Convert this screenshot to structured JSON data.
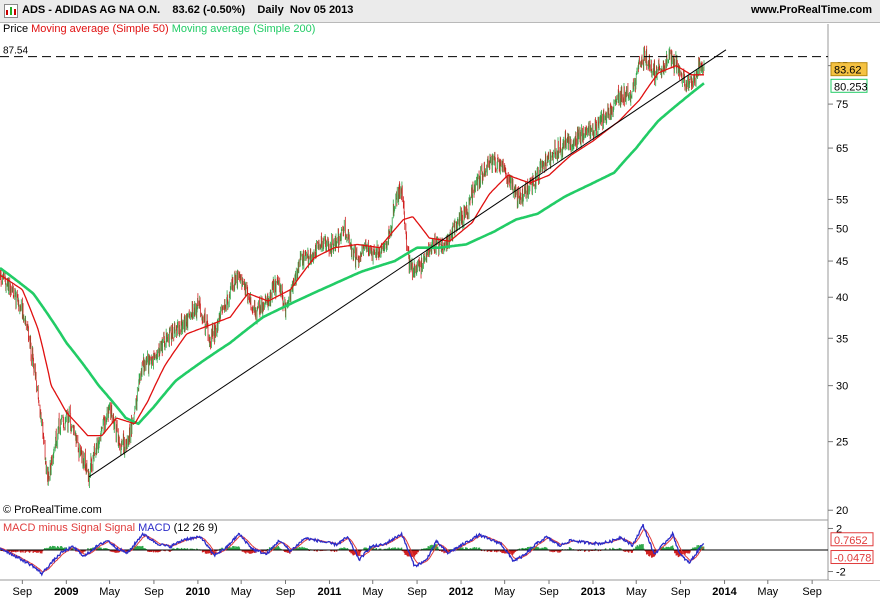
{
  "header": {
    "symbol": "ADS",
    "name": "ADIDAS AG NA O.N.",
    "last": "83.62",
    "change": "(-0.50%)",
    "period": "Daily",
    "date": "Nov 05 2013",
    "site": "www.ProRealTime.com"
  },
  "copyright": "© ProRealTime.com",
  "legend_price": {
    "price": "Price",
    "ma50": "Moving average (Simple 50)",
    "ma200": "Moving average (Simple 200)"
  },
  "legend_macd": {
    "hist": "MACD minus Signal Signal",
    "macd": "MACD",
    "params": "(12 26 9)"
  },
  "colors": {
    "up": "#2ea84a",
    "down": "#d02020",
    "ma50": "#e01010",
    "ma200": "#22cc66",
    "trend": "#000000",
    "macd": "#2b2bc8",
    "signal": "#e03c3c",
    "last_price_bg": "#f5c242",
    "ma200_tag_border": "#22cc66",
    "grid": "#ffffff"
  },
  "chart_data": [
    {
      "type": "candlestick",
      "title": "ADS - ADIDAS AG NA O.N.",
      "scale": "log",
      "ylim": [
        19.5,
        93
      ],
      "y_ticks": [
        20,
        25,
        30,
        35,
        40,
        45,
        50,
        55,
        65,
        75,
        85
      ],
      "x_ticks": [
        "Sep",
        "2009",
        "May",
        "Sep",
        "2010",
        "May",
        "Sep",
        "2011",
        "May",
        "Sep",
        "2012",
        "May",
        "Sep",
        "2013",
        "May",
        "Sep",
        "2014",
        "May",
        "Sep"
      ],
      "x_tick_dates": [
        "2008-09-01",
        "2009-01-01",
        "2009-05-01",
        "2009-09-01",
        "2010-01-01",
        "2010-05-01",
        "2010-09-01",
        "2011-01-01",
        "2011-05-01",
        "2011-09-01",
        "2012-01-01",
        "2012-05-01",
        "2012-09-01",
        "2013-01-01",
        "2013-05-01",
        "2013-09-01",
        "2014-01-01",
        "2014-05-01",
        "2014-09-01"
      ],
      "x_range": [
        "2008-07-01",
        "2014-10-15"
      ],
      "price_keypoints": [
        [
          "2008-07-01",
          43
        ],
        [
          "2008-08-15",
          40
        ],
        [
          "2008-09-15",
          36
        ],
        [
          "2008-10-15",
          29
        ],
        [
          "2008-11-10",
          22
        ],
        [
          "2008-12-10",
          26
        ],
        [
          "2009-01-10",
          27
        ],
        [
          "2009-02-10",
          24
        ],
        [
          "2009-03-05",
          22.5
        ],
        [
          "2009-04-01",
          25
        ],
        [
          "2009-05-01",
          28
        ],
        [
          "2009-06-01",
          24.5
        ],
        [
          "2009-07-01",
          26
        ],
        [
          "2009-08-01",
          32
        ],
        [
          "2009-09-01",
          33
        ],
        [
          "2009-10-01",
          34.5
        ],
        [
          "2009-11-01",
          36
        ],
        [
          "2009-12-01",
          37
        ],
        [
          "2010-01-05",
          39
        ],
        [
          "2010-02-05",
          35
        ],
        [
          "2010-03-01",
          37
        ],
        [
          "2010-04-20",
          43
        ],
        [
          "2010-05-20",
          40
        ],
        [
          "2010-06-10",
          38
        ],
        [
          "2010-07-05",
          39
        ],
        [
          "2010-08-10",
          42
        ],
        [
          "2010-09-01",
          38.5
        ],
        [
          "2010-10-15",
          45
        ],
        [
          "2010-11-15",
          46
        ],
        [
          "2010-12-15",
          48
        ],
        [
          "2011-01-10",
          47
        ],
        [
          "2011-02-10",
          50
        ],
        [
          "2011-03-15",
          45
        ],
        [
          "2011-04-15",
          47
        ],
        [
          "2011-05-15",
          46
        ],
        [
          "2011-06-15",
          49
        ],
        [
          "2011-07-10",
          56
        ],
        [
          "2011-07-20",
          57
        ],
        [
          "2011-08-10",
          44
        ],
        [
          "2011-09-15",
          44
        ],
        [
          "2011-10-10",
          48
        ],
        [
          "2011-11-15",
          47
        ],
        [
          "2011-12-15",
          50
        ],
        [
          "2012-01-15",
          53
        ],
        [
          "2012-02-15",
          58
        ],
        [
          "2012-03-15",
          61
        ],
        [
          "2012-04-10",
          62
        ],
        [
          "2012-05-15",
          59
        ],
        [
          "2012-06-10",
          55
        ],
        [
          "2012-07-10",
          57
        ],
        [
          "2012-08-10",
          61
        ],
        [
          "2012-09-15",
          64
        ],
        [
          "2012-10-15",
          66
        ],
        [
          "2012-11-15",
          67
        ],
        [
          "2012-12-15",
          68
        ],
        [
          "2013-01-15",
          70
        ],
        [
          "2013-02-15",
          73
        ],
        [
          "2013-03-15",
          77
        ],
        [
          "2013-04-15",
          77
        ],
        [
          "2013-05-10",
          86
        ],
        [
          "2013-05-25",
          88
        ],
        [
          "2013-06-15",
          83
        ],
        [
          "2013-07-15",
          85
        ],
        [
          "2013-08-05",
          88
        ],
        [
          "2013-08-25",
          84
        ],
        [
          "2013-09-20",
          80
        ],
        [
          "2013-10-10",
          82
        ],
        [
          "2013-10-25",
          85
        ],
        [
          "2013-11-05",
          83.62
        ]
      ],
      "ma50_keypoints": [
        [
          "2008-07-01",
          43
        ],
        [
          "2008-09-01",
          41
        ],
        [
          "2008-10-15",
          36
        ],
        [
          "2008-11-20",
          30
        ],
        [
          "2009-01-01",
          27.5
        ],
        [
          "2009-03-01",
          25.5
        ],
        [
          "2009-04-10",
          25.5
        ],
        [
          "2009-05-20",
          27
        ],
        [
          "2009-07-10",
          26.5
        ],
        [
          "2009-08-15",
          28.5
        ],
        [
          "2009-10-01",
          32
        ],
        [
          "2009-12-01",
          35.5
        ],
        [
          "2010-02-01",
          36.5
        ],
        [
          "2010-04-01",
          37.5
        ],
        [
          "2010-05-20",
          40.5
        ],
        [
          "2010-07-15",
          39.5
        ],
        [
          "2010-09-15",
          41
        ],
        [
          "2010-11-20",
          45.5
        ],
        [
          "2011-01-15",
          47
        ],
        [
          "2011-03-20",
          47.5
        ],
        [
          "2011-05-20",
          47
        ],
        [
          "2011-07-25",
          51.5
        ],
        [
          "2011-08-20",
          52
        ],
        [
          "2011-10-05",
          48.5
        ],
        [
          "2011-12-01",
          48
        ],
        [
          "2012-02-01",
          51
        ],
        [
          "2012-03-20",
          56
        ],
        [
          "2012-05-10",
          59.5
        ],
        [
          "2012-07-10",
          58
        ],
        [
          "2012-09-01",
          59.5
        ],
        [
          "2012-11-01",
          63.5
        ],
        [
          "2013-01-01",
          66.5
        ],
        [
          "2013-03-15",
          71
        ],
        [
          "2013-05-10",
          76
        ],
        [
          "2013-07-01",
          83
        ],
        [
          "2013-08-20",
          85
        ],
        [
          "2013-10-01",
          82.5
        ],
        [
          "2013-11-05",
          82.5
        ]
      ],
      "ma200_keypoints": [
        [
          "2008-07-01",
          44
        ],
        [
          "2008-10-01",
          40.5
        ],
        [
          "2009-01-01",
          34.5
        ],
        [
          "2009-04-01",
          30
        ],
        [
          "2009-06-15",
          27
        ],
        [
          "2009-07-20",
          26.5
        ],
        [
          "2009-09-01",
          28
        ],
        [
          "2009-11-01",
          30.5
        ],
        [
          "2010-01-15",
          32.5
        ],
        [
          "2010-04-01",
          34.5
        ],
        [
          "2010-07-01",
          37.5
        ],
        [
          "2010-10-01",
          39.5
        ],
        [
          "2011-01-01",
          41.5
        ],
        [
          "2011-04-01",
          43.5
        ],
        [
          "2011-07-01",
          45
        ],
        [
          "2011-09-01",
          47
        ],
        [
          "2011-11-01",
          47
        ],
        [
          "2012-01-15",
          47.5
        ],
        [
          "2012-04-01",
          49.5
        ],
        [
          "2012-06-01",
          51.5
        ],
        [
          "2012-08-01",
          52.5
        ],
        [
          "2012-10-15",
          55.5
        ],
        [
          "2013-01-01",
          58
        ],
        [
          "2013-03-01",
          60
        ],
        [
          "2013-05-01",
          65
        ],
        [
          "2013-07-01",
          71
        ],
        [
          "2013-09-01",
          75.5
        ],
        [
          "2013-11-05",
          80.253
        ]
      ],
      "trendline": [
        [
          "2009-03-05",
          22.3
        ],
        [
          "2014-01-05",
          89.5
        ]
      ],
      "resistance_level": 87.54,
      "last_price": 83.62,
      "ma200_last": 80.253
    },
    {
      "type": "line",
      "title": "MACD (12 26 9)",
      "ylim": [
        -2.6,
        2.6
      ],
      "y_ticks": [
        2,
        -2
      ],
      "series": [
        {
          "name": "MACD minus Signal Signal",
          "last": -0.0478
        },
        {
          "name": "MACD",
          "last": 0.7652
        }
      ],
      "macd_keypoints": [
        [
          "2008-07-01",
          0.2
        ],
        [
          "2008-08-20",
          -0.7
        ],
        [
          "2008-10-01",
          -1.5
        ],
        [
          "2008-10-25",
          -2.2
        ],
        [
          "2008-11-20",
          -1.2
        ],
        [
          "2008-12-20",
          -0.2
        ],
        [
          "2009-01-20",
          0.3
        ],
        [
          "2009-02-20",
          -0.6
        ],
        [
          "2009-03-20",
          0.2
        ],
        [
          "2009-04-25",
          0.9
        ],
        [
          "2009-05-20",
          0.2
        ],
        [
          "2009-06-20",
          -0.3
        ],
        [
          "2009-08-01",
          1.5
        ],
        [
          "2009-09-10",
          0.6
        ],
        [
          "2009-10-15",
          0.3
        ],
        [
          "2009-11-25",
          1.0
        ],
        [
          "2010-01-10",
          1.2
        ],
        [
          "2010-02-15",
          -0.5
        ],
        [
          "2010-03-20",
          0.2
        ],
        [
          "2010-04-25",
          1.5
        ],
        [
          "2010-06-01",
          0.1
        ],
        [
          "2010-07-10",
          -0.4
        ],
        [
          "2010-08-15",
          0.9
        ],
        [
          "2010-09-15",
          -0.1
        ],
        [
          "2010-10-25",
          1.1
        ],
        [
          "2010-12-10",
          0.8
        ],
        [
          "2011-01-20",
          0.5
        ],
        [
          "2011-02-20",
          1.2
        ],
        [
          "2011-03-25",
          -0.9
        ],
        [
          "2011-04-25",
          0.3
        ],
        [
          "2011-06-01",
          0.5
        ],
        [
          "2011-07-20",
          1.5
        ],
        [
          "2011-08-25",
          -1.5
        ],
        [
          "2011-09-25",
          -1.0
        ],
        [
          "2011-10-25",
          0.8
        ],
        [
          "2011-11-25",
          -0.3
        ],
        [
          "2012-01-10",
          0.6
        ],
        [
          "2012-02-20",
          1.4
        ],
        [
          "2012-03-20",
          1.0
        ],
        [
          "2012-04-20",
          0.6
        ],
        [
          "2012-05-25",
          -1.0
        ],
        [
          "2012-06-25",
          -0.5
        ],
        [
          "2012-07-25",
          0.5
        ],
        [
          "2012-08-25",
          1.2
        ],
        [
          "2012-10-01",
          0.4
        ],
        [
          "2012-11-01",
          0.9
        ],
        [
          "2012-12-10",
          0.7
        ],
        [
          "2013-01-20",
          0.6
        ],
        [
          "2013-02-20",
          0.8
        ],
        [
          "2013-03-20",
          1.2
        ],
        [
          "2013-04-20",
          0.4
        ],
        [
          "2013-05-20",
          2.3
        ],
        [
          "2013-06-20",
          -0.4
        ],
        [
          "2013-07-15",
          0.5
        ],
        [
          "2013-08-10",
          1.5
        ],
        [
          "2013-08-30",
          -0.4
        ],
        [
          "2013-09-25",
          -1.2
        ],
        [
          "2013-10-15",
          -0.3
        ],
        [
          "2013-10-30",
          0.5
        ],
        [
          "2013-11-05",
          0.7652
        ]
      ]
    }
  ]
}
